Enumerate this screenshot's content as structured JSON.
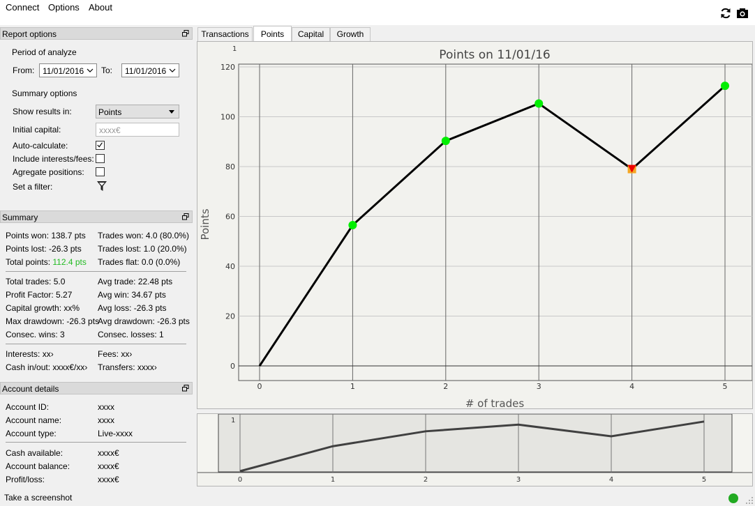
{
  "menu": {
    "connect": "Connect",
    "options": "Options",
    "about": "About"
  },
  "report_options": {
    "title": "Report options",
    "period_label": "Period of analyze",
    "from_label": "From:",
    "from_value": "11/01/2016",
    "to_label": "To:",
    "to_value": "11/01/2016",
    "summary_options_label": "Summary options",
    "show_results_label": "Show results in:",
    "show_results_value": "Points",
    "initial_capital_label": "Initial capital:",
    "initial_capital_placeholder": "xxxx€",
    "auto_calc_label": "Auto-calculate:",
    "auto_calc_checked": true,
    "include_fees_label": "Include interests/fees:",
    "include_fees_checked": false,
    "aggregate_label": "Agregate positions:",
    "aggregate_checked": false,
    "filter_label": "Set a filter:"
  },
  "summary": {
    "title": "Summary",
    "points_won": "Points won: 138.7 pts",
    "points_lost": "Points lost: -26.3 pts",
    "total_points_label": "Total points:",
    "total_points_value": "112.4 pts",
    "trades_won": "Trades won: 4.0 (80.0%)",
    "trades_lost": "Trades lost: 1.0 (20.0%)",
    "trades_flat": "Trades flat: 0.0 (0.0%)",
    "total_trades": "Total trades: 5.0",
    "profit_factor": "Profit Factor: 5.27",
    "capital_growth": "Capital growth: xx%",
    "max_drawdown": "Max drawdown: -26.3 pts",
    "consec_wins": "Consec. wins: 3",
    "avg_trade": "Avg trade: 22.48 pts",
    "avg_win": "Avg win: 34.67 pts",
    "avg_loss": "Avg loss: -26.3 pts",
    "avg_drawdown": "Avg drawdown: -26.3 pts",
    "consec_losses": "Consec. losses: 1",
    "interests": "Interests: xx›",
    "cash_inout": "Cash in/out: xxxx€/xx›",
    "fees": "Fees: xx›",
    "transfers": "Transfers: xxxx›"
  },
  "account": {
    "title": "Account details",
    "id_label": "Account ID:",
    "id_value": "xxxx",
    "name_label": "Account name:",
    "name_value": "xxxx",
    "type_label": "Account type:",
    "type_value": "Live-xxxx",
    "cash_label": "Cash available:",
    "cash_value": "xxxx€",
    "balance_label": "Account balance:",
    "balance_value": "xxxx€",
    "pl_label": "Profit/loss:",
    "pl_value": "xxxx€"
  },
  "tabs": [
    {
      "label": "Transactions",
      "active": false
    },
    {
      "label": "Points",
      "active": true
    },
    {
      "label": "Capital",
      "active": false
    },
    {
      "label": "Growth",
      "active": false
    }
  ],
  "status": {
    "text": "Take a screenshot",
    "indicator_color": "#22aa22"
  },
  "colors": {
    "win_point": "#00ee00",
    "loss_point": "#ee0000",
    "total_points": "#22bb22"
  },
  "chart_data": [
    {
      "type": "line",
      "title": "Points on 11/01/16",
      "xlabel": "# of trades",
      "ylabel": "Points",
      "x": [
        0,
        1,
        2,
        3,
        4,
        5
      ],
      "y": [
        0,
        56.5,
        90.3,
        105.3,
        79.0,
        112.4
      ],
      "point_kind": [
        "none",
        "win",
        "win",
        "win",
        "loss",
        "win"
      ],
      "xlim": [
        0,
        5
      ],
      "ylim": [
        0,
        120
      ],
      "yticks": [
        0,
        20,
        40,
        60,
        80,
        100,
        120
      ],
      "xticks": [
        0,
        1,
        2,
        3,
        4,
        5
      ],
      "grid": true,
      "corner_label": "1"
    },
    {
      "type": "line",
      "title": "",
      "x": [
        0,
        1,
        2,
        3,
        4,
        5
      ],
      "y": [
        0,
        56.5,
        90.3,
        105.3,
        79.0,
        112.4
      ],
      "xticks": [
        0,
        1,
        2,
        3,
        4,
        5
      ],
      "corner_label": "1"
    }
  ]
}
